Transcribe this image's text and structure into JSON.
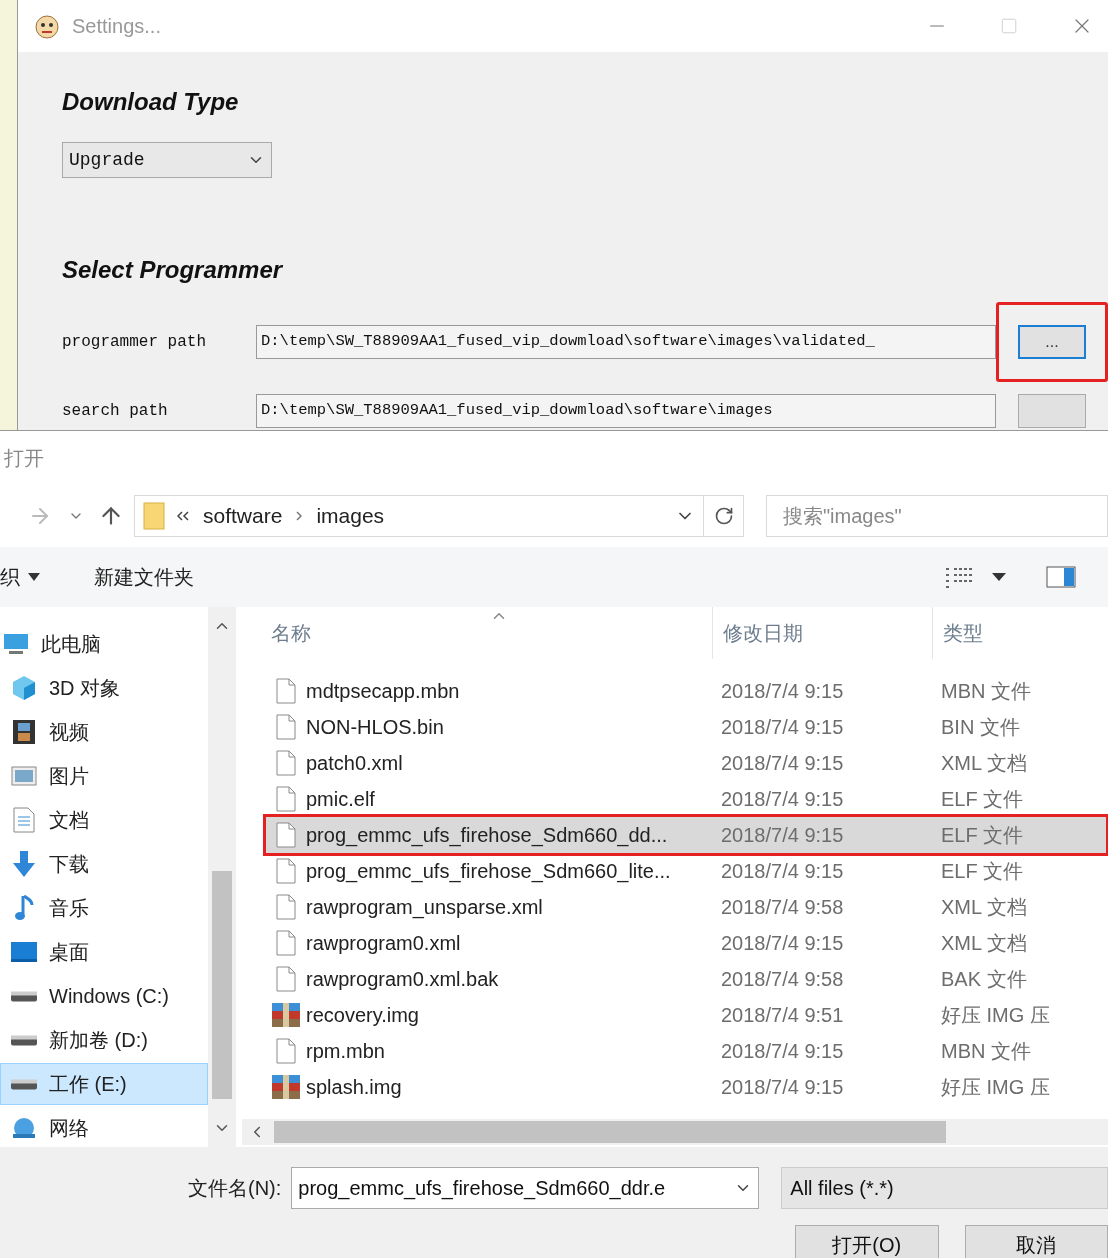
{
  "settings_window": {
    "title": "Settings...",
    "section_download": "Download Type",
    "download_type": {
      "value": "Upgrade"
    },
    "section_programmer": "Select Programmer",
    "paths": [
      {
        "label": "programmer path",
        "value": "D:\\temp\\SW_T88909AA1_fused_vip_dowmload\\software\\images\\validated_",
        "button": "...",
        "highlighted": true
      },
      {
        "label": "search path",
        "value": "D:\\temp\\SW_T88909AA1_fused_vip_dowmload\\software\\images",
        "highlighted": false
      }
    ]
  },
  "open_dialog": {
    "title": "打开",
    "breadcrumb": [
      "software",
      "images"
    ],
    "search": {
      "placeholder": "搜索\"images\""
    },
    "toolbar": {
      "organize": "织",
      "new_folder": "新建文件夹"
    },
    "sidebar": [
      {
        "label": "此电脑",
        "kind": "pc",
        "selected": false
      },
      {
        "label": "3D 对象",
        "kind": "cube",
        "selected": false
      },
      {
        "label": "视频",
        "kind": "video",
        "selected": false
      },
      {
        "label": "图片",
        "kind": "picture",
        "selected": false
      },
      {
        "label": "文档",
        "kind": "doc",
        "selected": false
      },
      {
        "label": "下载",
        "kind": "download",
        "selected": false
      },
      {
        "label": "音乐",
        "kind": "music",
        "selected": false
      },
      {
        "label": "桌面",
        "kind": "desktop",
        "selected": false
      },
      {
        "label": "Windows (C:)",
        "kind": "drive",
        "selected": false
      },
      {
        "label": "新加卷 (D:)",
        "kind": "drive",
        "selected": false
      },
      {
        "label": "工作 (E:)",
        "kind": "drive",
        "selected": true
      },
      {
        "label": "网络",
        "kind": "network",
        "selected": false
      }
    ],
    "columns": [
      "名称",
      "修改日期",
      "类型"
    ],
    "rows": [
      {
        "name": "mdtpsecapp.mbn",
        "date": "2018/7/4 9:15",
        "type": "MBN 文件",
        "kind": "file",
        "selected": false
      },
      {
        "name": "NON-HLOS.bin",
        "date": "2018/7/4 9:15",
        "type": "BIN 文件",
        "kind": "file",
        "selected": false
      },
      {
        "name": "patch0.xml",
        "date": "2018/7/4 9:15",
        "type": "XML 文档",
        "kind": "file",
        "selected": false
      },
      {
        "name": "pmic.elf",
        "date": "2018/7/4 9:15",
        "type": "ELF 文件",
        "kind": "file",
        "selected": false
      },
      {
        "name": "prog_emmc_ufs_firehose_Sdm660_dd...",
        "date": "2018/7/4 9:15",
        "type": "ELF 文件",
        "kind": "file",
        "selected": true
      },
      {
        "name": "prog_emmc_ufs_firehose_Sdm660_lite...",
        "date": "2018/7/4 9:15",
        "type": "ELF 文件",
        "kind": "file",
        "selected": false
      },
      {
        "name": "rawprogram_unsparse.xml",
        "date": "2018/7/4 9:58",
        "type": "XML 文档",
        "kind": "file",
        "selected": false
      },
      {
        "name": "rawprogram0.xml",
        "date": "2018/7/4 9:15",
        "type": "XML 文档",
        "kind": "file",
        "selected": false
      },
      {
        "name": "rawprogram0.xml.bak",
        "date": "2018/7/4 9:58",
        "type": "BAK 文件",
        "kind": "file",
        "selected": false
      },
      {
        "name": "recovery.img",
        "date": "2018/7/4 9:51",
        "type": "好压 IMG 压",
        "kind": "archive",
        "selected": false
      },
      {
        "name": "rpm.mbn",
        "date": "2018/7/4 9:15",
        "type": "MBN 文件",
        "kind": "file",
        "selected": false
      },
      {
        "name": "splash.img",
        "date": "2018/7/4 9:15",
        "type": "好压 IMG 压",
        "kind": "archive",
        "selected": false
      }
    ],
    "filename_label": "文件名(N):",
    "filename": "prog_emmc_ufs_firehose_Sdm660_ddr.e",
    "filter": "All files (*.*)",
    "buttons": [
      "打开(O)",
      "取消"
    ]
  }
}
